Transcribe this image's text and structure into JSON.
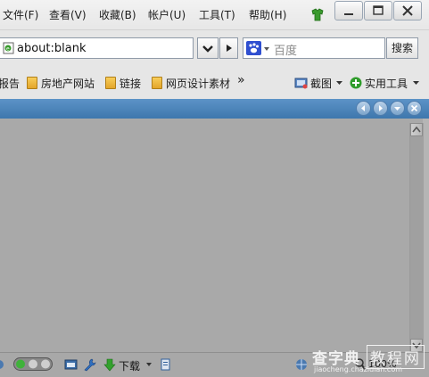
{
  "menu": [
    "文件(F)",
    "查看(V)",
    "收藏(B)",
    "帐户(U)",
    "工具(T)",
    "帮助(H)"
  ],
  "window_controls": [
    "minimize-icon",
    "maximize-icon",
    "close-icon"
  ],
  "address": {
    "url": "about:blank"
  },
  "search": {
    "placeholder": "百度",
    "button_label": "搜索"
  },
  "favorites": {
    "items": [
      "报告",
      "房地产网站",
      "链接",
      "网页设计素材"
    ],
    "overflow": "»",
    "screenshot_label": "截图",
    "tools_label": "实用工具"
  },
  "status": {
    "download_label": "下载",
    "zoom_label": "100%"
  },
  "watermark": {
    "main": "查字典",
    "box": "教程网",
    "url": "jiaocheng.chazidian.com"
  },
  "colors": {
    "tab_strip": "#4a82b8",
    "content_bg": "#a9a9a9",
    "toolbar_bg": "#e6e6e6"
  }
}
